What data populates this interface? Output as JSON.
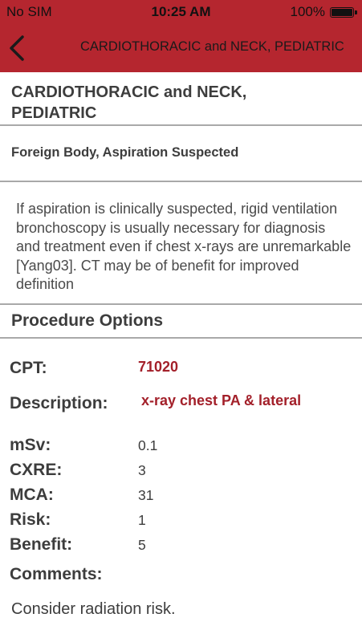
{
  "status_bar": {
    "carrier": "No SIM",
    "time": "10:25 AM",
    "battery": "100%"
  },
  "nav": {
    "back_icon": "chevron-left-icon",
    "title": "CARDIOTHORACIC and NECK, PEDIATRIC",
    "bar_color": "#b5262f"
  },
  "page": {
    "title": "CARDIOTHORACIC and NECK, PEDIATRIC",
    "subtitle": "Foreign Body, Aspiration Suspected",
    "description": "If aspiration is clinically suspected, rigid ventilation bronchoscopy is usually necessary for diagnosis and treatment even if chest x-rays are unremarkable [Yang03]. CT may be of benefit for improved definition"
  },
  "procedure": {
    "heading": "Procedure Options",
    "cpt_label": "CPT:",
    "cpt_value": "71020",
    "description_label": "Description:",
    "description_value": "x-ray chest PA & lateral",
    "msv_label": "mSv:",
    "msv_value": "0.1",
    "cxre_label": "CXRE:",
    "cxre_value": "3",
    "mca_label": "MCA:",
    "mca_value": "31",
    "risk_label": "Risk:",
    "risk_value": "1",
    "benefit_label": "Benefit:",
    "benefit_value": "5",
    "comments_label": "Comments:",
    "comments_value": "Consider radiation risk.",
    "accent_color": "#a3202a"
  }
}
